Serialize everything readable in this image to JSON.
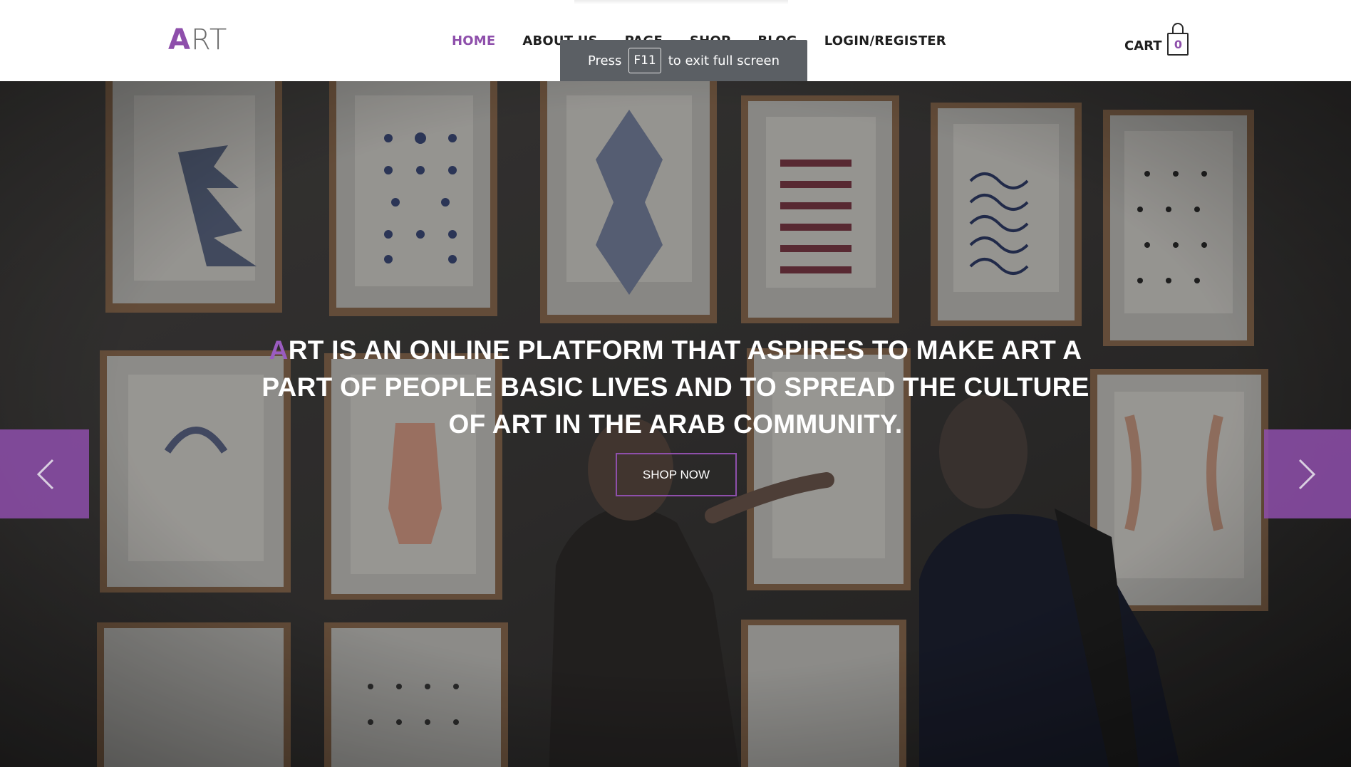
{
  "header": {
    "logo": {
      "first_letter": "A",
      "rest": "RT"
    },
    "nav": [
      {
        "label": "HOME",
        "active": true
      },
      {
        "label": "ABOUT US",
        "active": false
      },
      {
        "label": "PAGE",
        "active": false
      },
      {
        "label": "SHOP",
        "active": false
      },
      {
        "label": "BLOG",
        "active": false
      },
      {
        "label": "LOGIN/REGISTER",
        "active": false
      }
    ],
    "cart": {
      "label": "CART",
      "count": "0",
      "icon": "shopping-bag-icon"
    }
  },
  "fullscreen_notice": {
    "prefix": "Press",
    "key": "F11",
    "suffix": "to exit full screen"
  },
  "hero": {
    "headline_first": "A",
    "headline_rest": "RT IS AN ONLINE PLATFORM THAT ASPIRES TO MAKE ART A PART OF PEOPLE BASIC LIVES AND TO SPREAD THE CULTURE OF ART IN THE ARAB COMMUNITY.",
    "cta_label": "SHOP NOW",
    "prev_icon": "chevron-left-icon",
    "next_icon": "chevron-right-icon"
  },
  "colors": {
    "accent": "#8e4fab",
    "nav_text": "#1f1f1f",
    "toast_bg": "#5b5f64",
    "hero_wall": "#3a3837"
  }
}
